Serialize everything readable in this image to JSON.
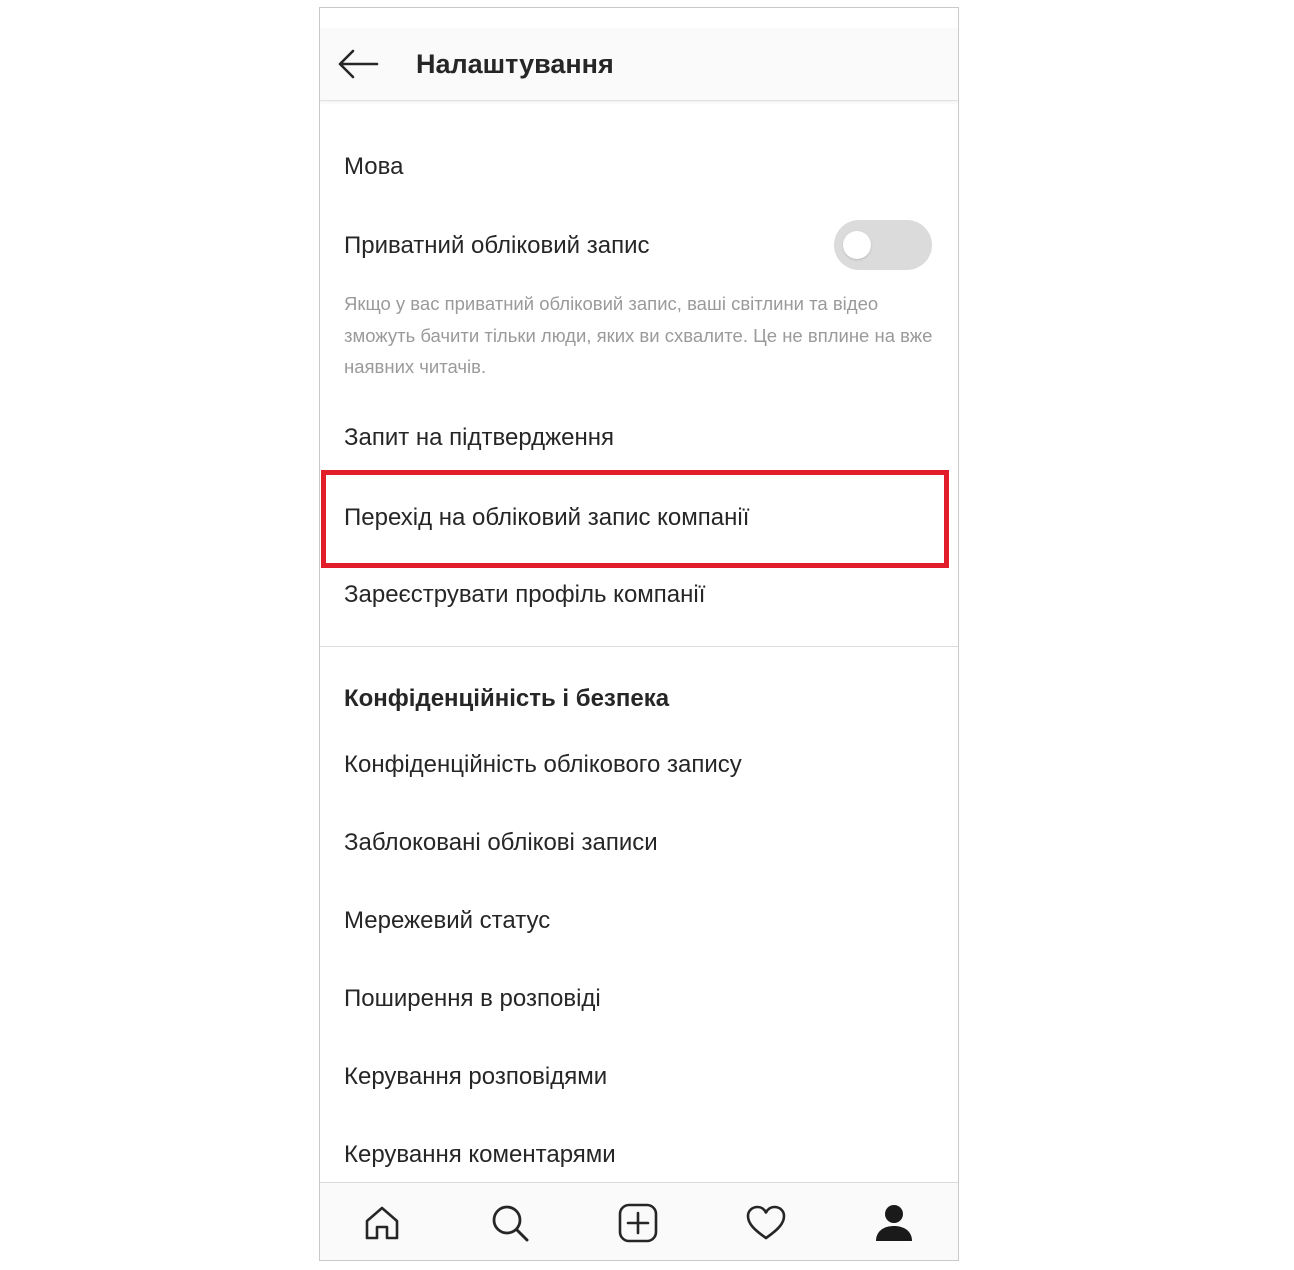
{
  "header": {
    "title": "Налаштування"
  },
  "settings": {
    "items": [
      {
        "label": "Мова"
      },
      {
        "label": "Приватний обліковий запис"
      },
      {
        "label": "Запит на підтвердження"
      },
      {
        "label": "Перехід на обліковий запис компанії"
      },
      {
        "label": "Зареєструвати профіль компанії"
      }
    ],
    "private_toggle_on": false,
    "private_hint": "Якщо у вас приватний обліковий запис, ваші світлини та відео зможуть бачити тільки люди, яких ви схвалите. Це не вплине на вже наявних читачів."
  },
  "privacy_section": {
    "title": "Конфіденційність і безпека",
    "items": [
      {
        "label": "Конфіденційність облікового запису"
      },
      {
        "label": "Заблоковані облікові записи"
      },
      {
        "label": "Мережевий статус"
      },
      {
        "label": "Поширення в розповіді"
      },
      {
        "label": "Керування розповідями"
      },
      {
        "label": "Керування коментарями"
      }
    ]
  },
  "highlight_color": "#e11d2a",
  "tabbar": {
    "icons": [
      "home-icon",
      "search-icon",
      "add-post-icon",
      "heart-icon",
      "profile-icon"
    ]
  }
}
